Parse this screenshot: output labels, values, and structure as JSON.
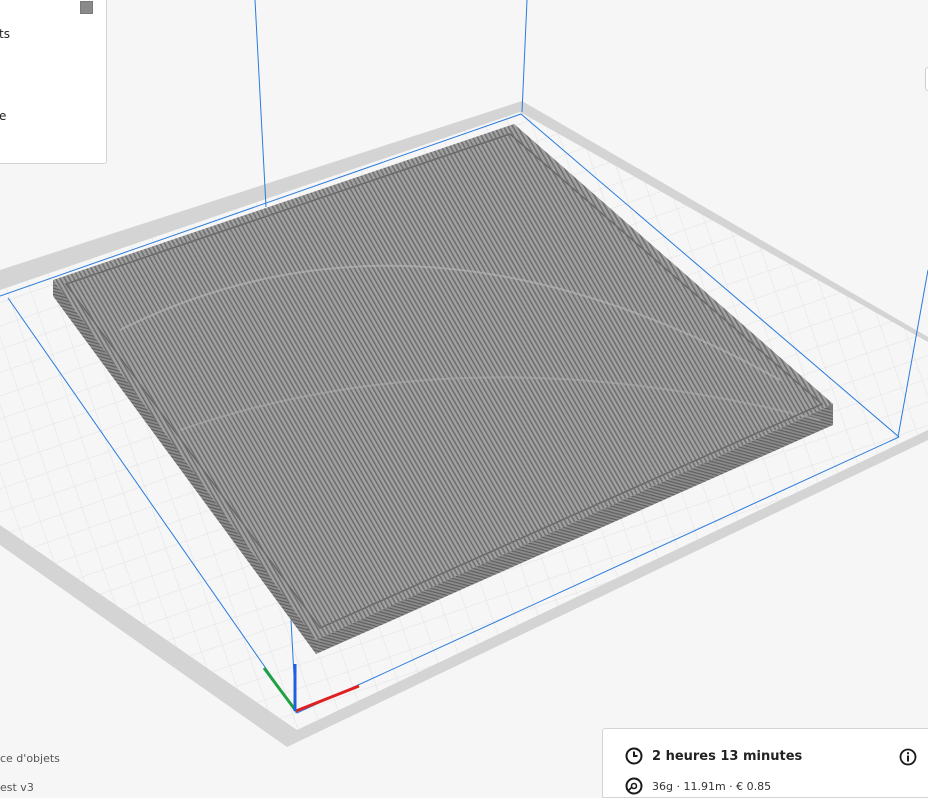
{
  "legend": {
    "line1": "ts",
    "line2": "e",
    "swatch_color": "#8a8a8a"
  },
  "scene": {
    "bed_color": "#d4d4d4",
    "grid_color": "#f3f3f3",
    "volume_line_color": "#2a7bde",
    "model_color": "#8e8e8e",
    "axis_x_color": "#e02020",
    "axis_y_color": "#1fa043",
    "axis_z_color": "#2060e0"
  },
  "bottom_left": {
    "line1": "ce d'objets",
    "line2": "est v3"
  },
  "print_info": {
    "time": "2 heures 13 minutes",
    "material": "36g · 11.91m · € 0.85"
  }
}
